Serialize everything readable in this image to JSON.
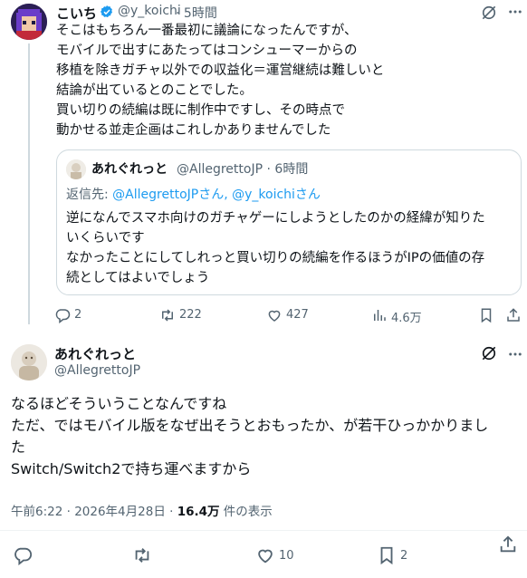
{
  "tweet": {
    "author_name": "こいち",
    "handle": "@y_koichi",
    "separator": "·",
    "time": "5時間",
    "body_lines": [
      "そこはもちろん一番最初に議論になったんですが、",
      "モバイルで出すにあたってはコンシューマーからの",
      "移植を除きガチャ以外での収益化＝運営継続は難しいと",
      "結論が出ているとのことでした。",
      "買い切りの続編は既に制作中ですし、その時点で",
      "動かせる並走企画はこれしかありませんでした"
    ],
    "quote": {
      "author_name": "あれぐれっと",
      "handle": "@AllegrettoJP",
      "separator": "·",
      "time": "6時間",
      "reply_prefix": "返信先: ",
      "reply_to": "@AllegrettoJPさん, @y_koichiさん",
      "body_lines": [
        "逆になんでスマホ向けのガチャゲーにしようとしたのかの経緯が知りた",
        "いくらいです",
        "なかったことにしてしれっと買い切りの続編を作るほうがIPの価値の存",
        "続としてはよいでしょう"
      ]
    },
    "actions": {
      "replies": "2",
      "reposts": "222",
      "likes": "427",
      "views": "4.6万"
    }
  },
  "main_tweet": {
    "author_name": "あれぐれっと",
    "handle": "@AllegrettoJP",
    "body_lines": [
      "なるほどそういうことなんですね",
      "ただ、ではモバイル版をなぜ出そうとおもったか、が若干ひっかかりまし",
      "た",
      "Switch/Switch2で持ち運べますから"
    ],
    "timestamp": "午前6:22 · 2026年4月28日 · ",
    "view_count": "16.4万",
    "view_suffix": " 件の表示",
    "actions": {
      "likes": "10",
      "bookmarks": "2"
    }
  },
  "colors": {
    "text": "#0f1419",
    "muted": "#536471",
    "link": "#1d9bf0",
    "verified": "#1d9bf0",
    "border": "#cfd9de"
  }
}
